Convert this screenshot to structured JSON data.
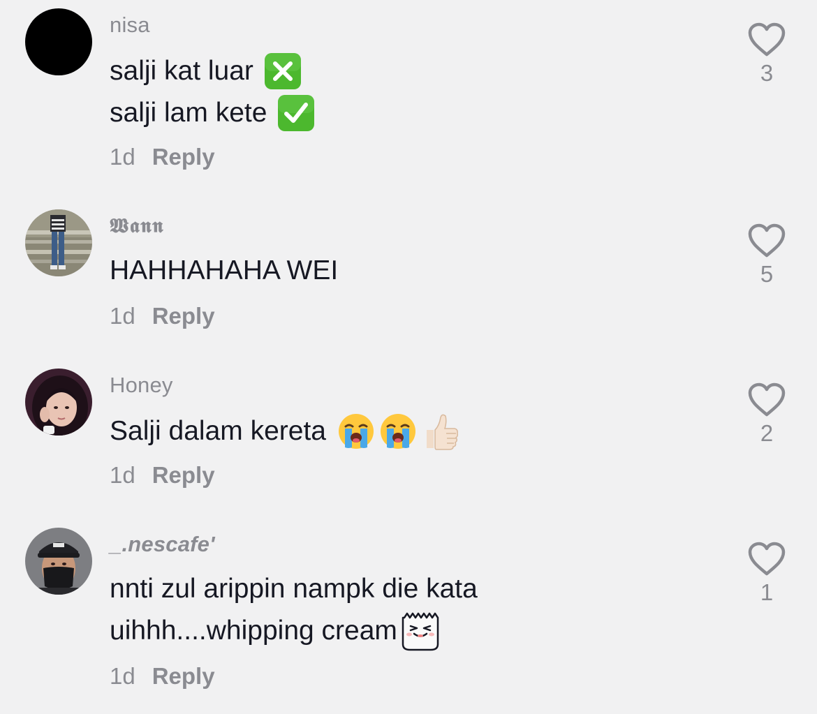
{
  "comments": [
    {
      "username": "nisa",
      "lines": [
        "salji kat luar",
        "salji lam kete"
      ],
      "line_emojis": [
        "cross-mark-button-emoji",
        "check-mark-button-emoji"
      ],
      "date": "1d",
      "reply_label": "Reply",
      "like_count": "3"
    },
    {
      "username": "𝖂𝖆𝖓𝖓",
      "lines": [
        "HAHHAHAHA WEI"
      ],
      "date": "1d",
      "reply_label": "Reply",
      "like_count": "5"
    },
    {
      "username": "Honey",
      "lines": [
        "Salji dalam kereta"
      ],
      "line_emojis": [
        "loudly-crying-face-emoji x2, thumbs-up-emoji"
      ],
      "date": "1d",
      "reply_label": "Reply",
      "like_count": "2"
    },
    {
      "username": "_.nescafe'",
      "lines": [
        "nnti zul arippin nampk die kata",
        "uihhh....whipping cream"
      ],
      "line_emojis": [
        "",
        "tiktok-laughing-sticker-emoji"
      ],
      "date": "1d",
      "reply_label": "Reply",
      "like_count": "1"
    }
  ],
  "colors": {
    "background": "#f1f1f2",
    "text": "#161823",
    "muted": "#8a8b91",
    "emoji_green": "#4cb82e"
  }
}
